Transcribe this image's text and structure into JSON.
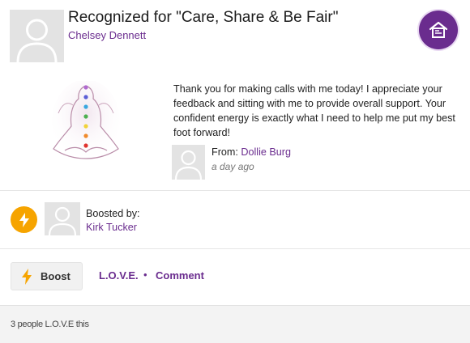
{
  "header": {
    "title": "Recognized for \"Care, Share & Be Fair\"",
    "recipient": "Chelsey Dennett",
    "badge_icon": "award-house-icon",
    "accent_color": "#6a2c8e"
  },
  "award": {
    "image": "chakra-meditation-figure"
  },
  "message": {
    "text": "Thank you for making calls with me today! I appreciate your feedback and sitting with me to provide overall support. Your confident energy is exactly what I need to help me put my best foot forward!",
    "from_label": "From:",
    "from_name": "Dollie Burg",
    "time_ago": "a day ago"
  },
  "boost": {
    "label": "Boosted by:",
    "booster": "Kirk Tucker",
    "icon": "lightning-icon",
    "color": "#f6a400"
  },
  "actions": {
    "boost_label": "Boost",
    "love_label": "L.O.V.E.",
    "separator": "•",
    "comment_label": "Comment"
  },
  "footer": {
    "love_count_text": "3 people L.O.V.E this"
  }
}
